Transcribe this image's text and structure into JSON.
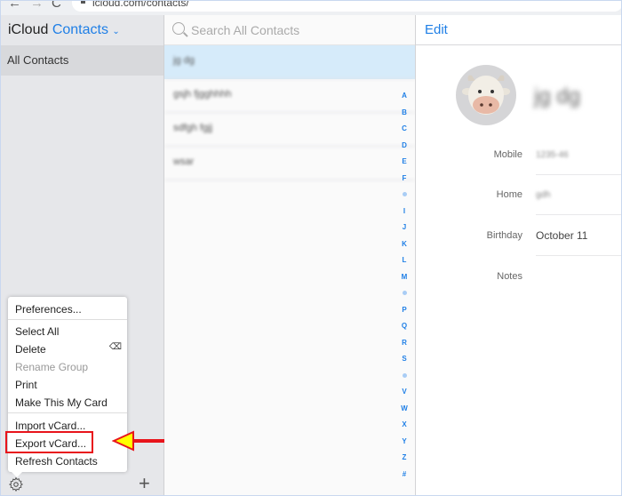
{
  "browser": {
    "back_glyph": "←",
    "forward_glyph": "→",
    "reload_glyph": "C",
    "url": "icloud.com/contacts/"
  },
  "sidebar": {
    "brand": "iCloud",
    "app": "Contacts",
    "app_chevron": "⌄",
    "groups": [
      {
        "label": "All Contacts",
        "selected": true
      }
    ]
  },
  "menu": {
    "items": [
      {
        "label": "Preferences...",
        "enabled": true
      },
      {
        "label": "Select All",
        "enabled": true
      },
      {
        "label": "Delete",
        "enabled": true,
        "shortcut": "⌫"
      },
      {
        "label": "Rename Group",
        "enabled": false
      },
      {
        "label": "Print",
        "enabled": true
      },
      {
        "label": "Make This My Card",
        "enabled": true
      },
      {
        "label": "Import vCard...",
        "enabled": true
      },
      {
        "label": "Export vCard...",
        "enabled": true,
        "highlighted": true
      },
      {
        "label": "Refresh Contacts",
        "enabled": true
      }
    ],
    "highlight_color": "#e8141b",
    "arrow_fill": "#ffff00"
  },
  "footer": {
    "gear_icon": "gear-icon",
    "add_glyph": "+"
  },
  "list": {
    "search_placeholder": "Search All Contacts",
    "contacts": [
      {
        "name": "jg dg",
        "selected": true
      },
      {
        "name": "gsjh fjgghhhh",
        "selected": false
      },
      {
        "name": "sdfgh fgjj",
        "selected": false
      },
      {
        "name": "wsar",
        "selected": false
      }
    ],
    "index": [
      "A",
      "B",
      "C",
      "D",
      "E",
      "F",
      "•",
      "I",
      "J",
      "K",
      "L",
      "M",
      "•",
      "P",
      "Q",
      "R",
      "S",
      "•",
      "V",
      "W",
      "X",
      "Y",
      "Z",
      "#"
    ],
    "accent": "#1f7fe6"
  },
  "detail": {
    "edit_label": "Edit",
    "name": "jg dg",
    "avatar": "cow-memoji",
    "fields": [
      {
        "label": "Mobile",
        "value": "1235-46",
        "blurred": true
      },
      {
        "label": "Home",
        "value": "gdh",
        "blurred": true
      },
      {
        "label": "Birthday",
        "value": "October 11",
        "blurred": false
      },
      {
        "label": "Notes",
        "value": "",
        "blurred": false
      }
    ]
  }
}
